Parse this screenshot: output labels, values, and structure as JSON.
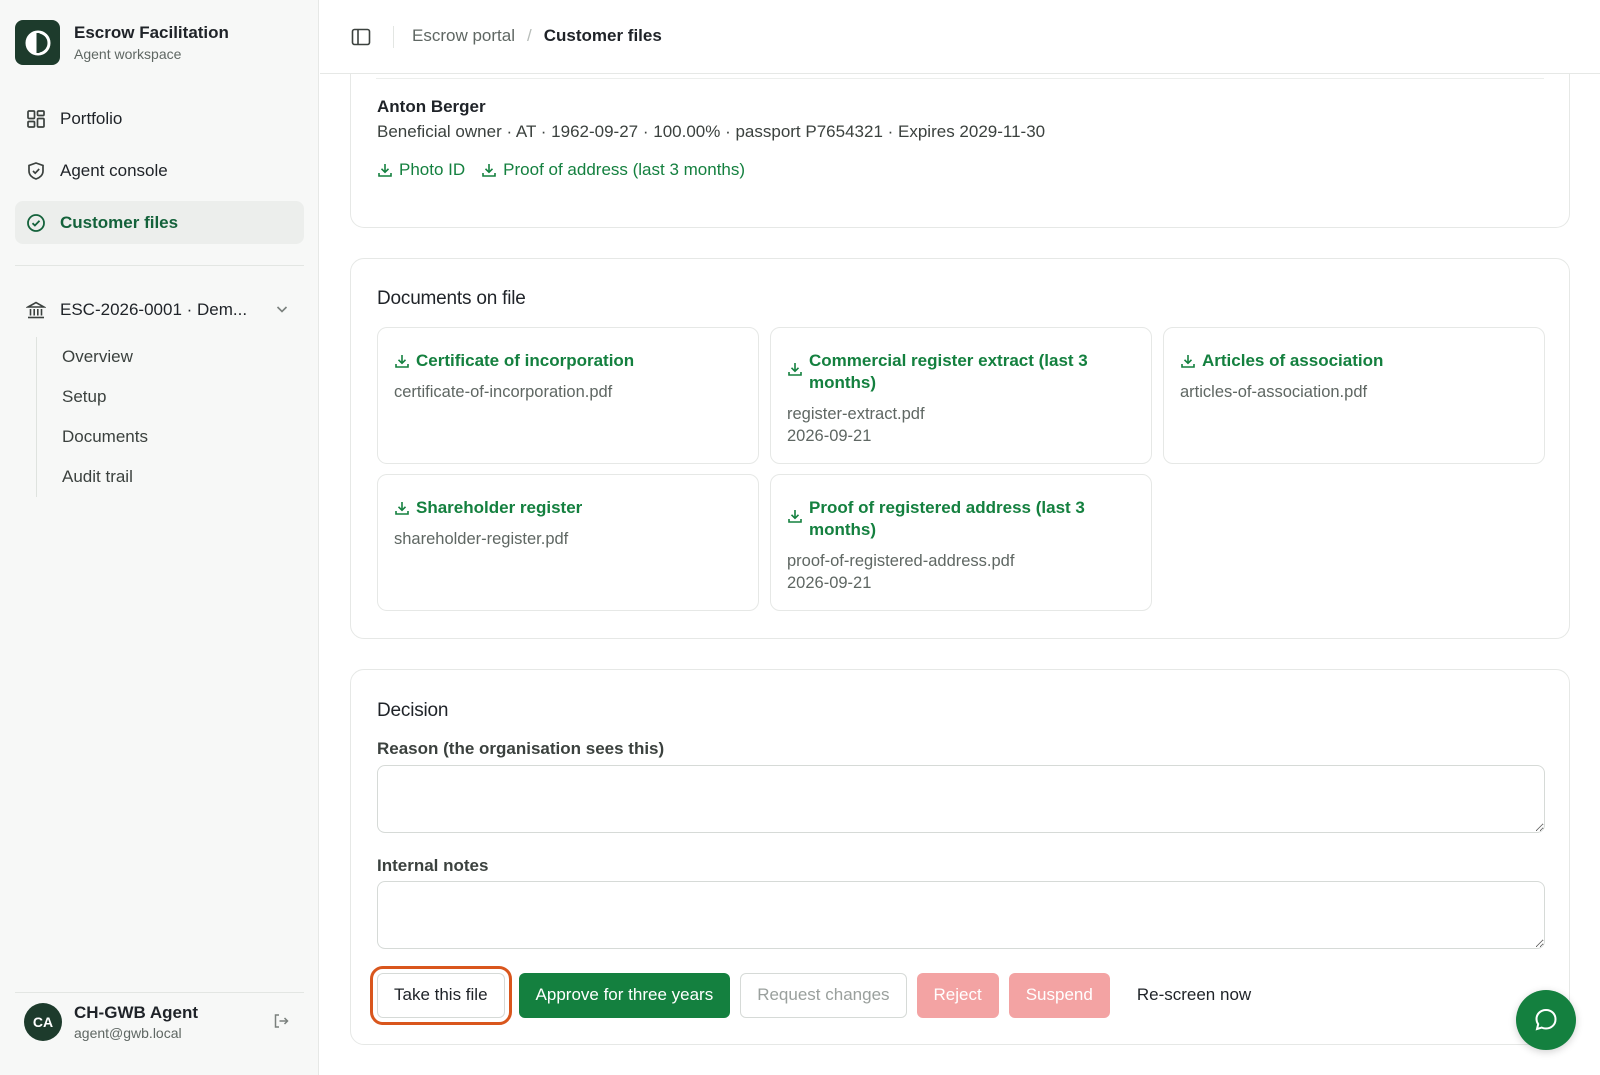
{
  "brand": {
    "title": "Escrow Facilitation",
    "subtitle": "Agent workspace"
  },
  "nav": [
    {
      "label": "Portfolio",
      "icon": "grid-icon"
    },
    {
      "label": "Agent console",
      "icon": "shield-icon"
    },
    {
      "label": "Customer files",
      "icon": "check-circle-icon",
      "active": true
    }
  ],
  "escrow": {
    "label": "ESC-2026-0001 · Dem...",
    "icon": "bank-icon"
  },
  "subnav": [
    "Overview",
    "Setup",
    "Documents",
    "Audit trail"
  ],
  "user": {
    "initials": "CA",
    "name": "CH-GWB Agent",
    "email": "agent@gwb.local"
  },
  "breadcrumb": {
    "parent": "Escrow portal",
    "separator": "/",
    "current": "Customer files"
  },
  "owner": {
    "name": "Anton Berger",
    "meta": "Beneficial owner · AT · 1962-09-27 · 100.00% · passport P7654321 · Expires 2029-11-30",
    "links": [
      "Photo ID",
      "Proof of address (last 3 months)"
    ]
  },
  "documents": {
    "title": "Documents on file",
    "items": [
      {
        "title": "Certificate of incorporation",
        "file": "certificate-of-incorporation.pdf",
        "date": ""
      },
      {
        "title": "Commercial register extract (last 3 months)",
        "file": "register-extract.pdf",
        "date": "2026-09-21"
      },
      {
        "title": "Articles of association",
        "file": "articles-of-association.pdf",
        "date": ""
      },
      {
        "title": "Shareholder register",
        "file": "shareholder-register.pdf",
        "date": ""
      },
      {
        "title": "Proof of registered address (last 3 months)",
        "file": "proof-of-registered-address.pdf",
        "date": "2026-09-21"
      }
    ]
  },
  "decision": {
    "title": "Decision",
    "reason_label": "Reason (the organisation sees this)",
    "reason_value": "",
    "notes_label": "Internal notes",
    "notes_value": "",
    "buttons": {
      "take": "Take this file",
      "approve": "Approve for three years",
      "request": "Request changes",
      "reject": "Reject",
      "suspend": "Suspend",
      "rescreen": "Re-screen now"
    }
  },
  "colors": {
    "accent": "#14803f",
    "brand_dark": "#1d3b2c",
    "danger_disabled": "#f3a3a3",
    "focus_ring": "#d9561d"
  }
}
